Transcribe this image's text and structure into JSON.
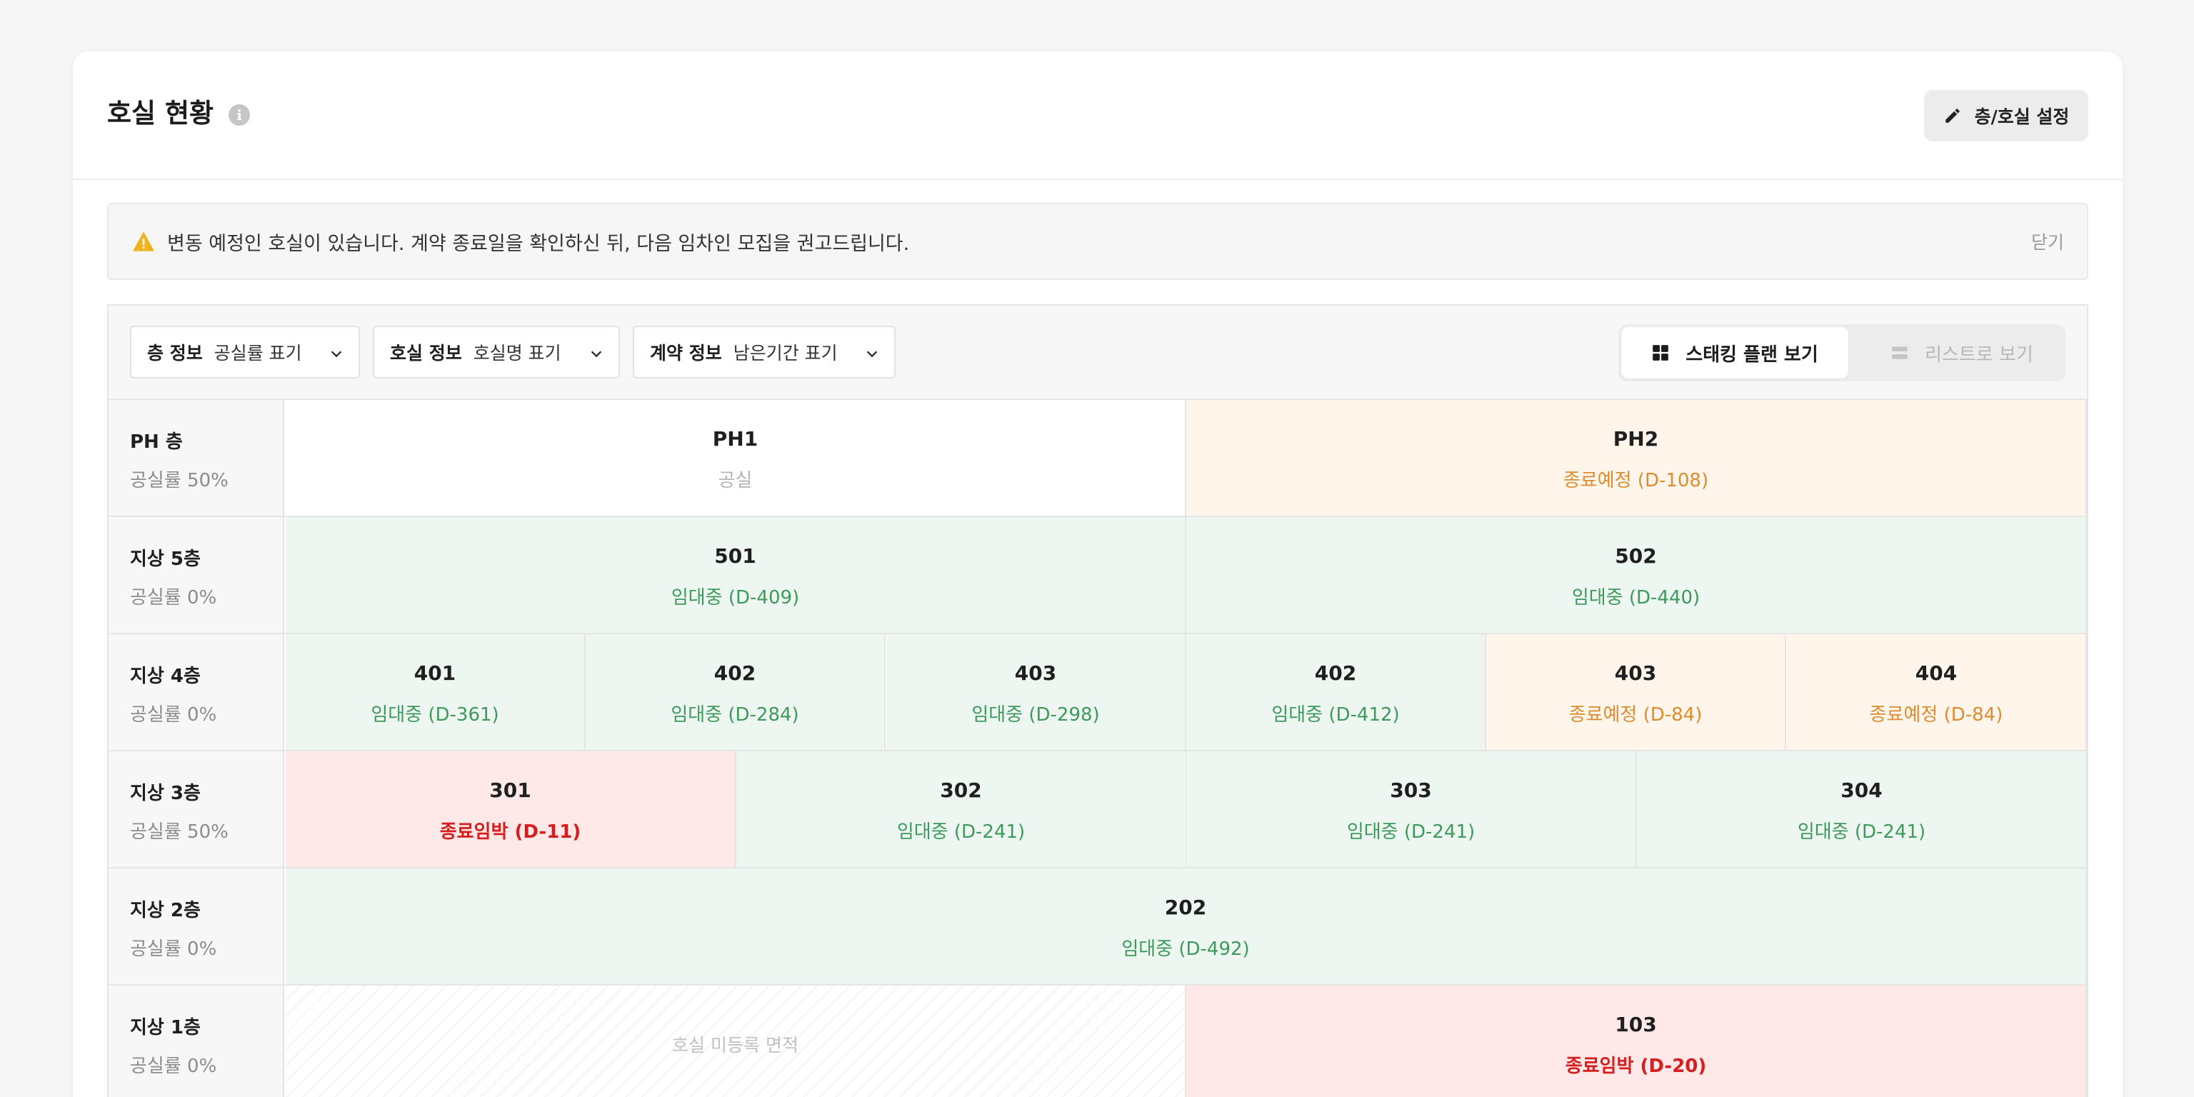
{
  "header": {
    "title": "호실 현황",
    "info_icon": "info-icon",
    "settings_button": "층/호실 설정",
    "settings_icon": "pencil-icon"
  },
  "alert": {
    "icon": "warning-icon",
    "message": "변동 예정인 호실이 있습니다. 계약 종료일을 확인하신 뒤, 다음 임차인 모집을 권고드립니다.",
    "close": "닫기"
  },
  "toolbar": {
    "filters": [
      {
        "label": "층 정보",
        "value": "공실률 표기"
      },
      {
        "label": "호실 정보",
        "value": "호실명 표기"
      },
      {
        "label": "계약 정보",
        "value": "남은기간 표기"
      }
    ],
    "views": [
      {
        "label": "스태킹 플랜 보기",
        "icon": "grid-icon",
        "active": true
      },
      {
        "label": "리스트로 보기",
        "icon": "list-icon",
        "active": false
      }
    ]
  },
  "colors": {
    "leased": "#3d9a5c",
    "ending": "#de8b2f",
    "urgent": "#d71e1e",
    "vacant": "#b5b5b5"
  },
  "floors": [
    {
      "name": "PH 층",
      "vacancy": "공실률 50%",
      "units": [
        {
          "name": "PH1",
          "status": "공실",
          "state": "vacant"
        },
        {
          "name": "PH2",
          "status": "종료예정 (D-108)",
          "state": "ending"
        }
      ]
    },
    {
      "name": "지상 5층",
      "vacancy": "공실률 0%",
      "units": [
        {
          "name": "501",
          "status": "임대중 (D-409)",
          "state": "leased"
        },
        {
          "name": "502",
          "status": "임대중 (D-440)",
          "state": "leased"
        }
      ]
    },
    {
      "name": "지상 4층",
      "vacancy": "공실률 0%",
      "units": [
        {
          "name": "401",
          "status": "임대중 (D-361)",
          "state": "leased"
        },
        {
          "name": "402",
          "status": "임대중 (D-284)",
          "state": "leased"
        },
        {
          "name": "403",
          "status": "임대중 (D-298)",
          "state": "leased"
        },
        {
          "name": "402",
          "status": "임대중 (D-412)",
          "state": "leased"
        },
        {
          "name": "403",
          "status": "종료예정 (D-84)",
          "state": "ending"
        },
        {
          "name": "404",
          "status": "종료예정 (D-84)",
          "state": "ending"
        }
      ]
    },
    {
      "name": "지상 3층",
      "vacancy": "공실률 50%",
      "units": [
        {
          "name": "301",
          "status": "종료임박 (D-11)",
          "state": "urgent"
        },
        {
          "name": "302",
          "status": "임대중 (D-241)",
          "state": "leased"
        },
        {
          "name": "303",
          "status": "임대중 (D-241)",
          "state": "leased"
        },
        {
          "name": "304",
          "status": "임대중 (D-241)",
          "state": "leased"
        }
      ]
    },
    {
      "name": "지상 2층",
      "vacancy": "공실률 0%",
      "units": [
        {
          "name": "202",
          "status": "임대중 (D-492)",
          "state": "leased"
        }
      ]
    },
    {
      "name": "지상 1층",
      "vacancy": "공실률 0%",
      "units": [
        {
          "name": "",
          "status": "",
          "note": "호실 미등록 면적",
          "state": "unreg"
        },
        {
          "name": "103",
          "status": "종료임박 (D-20)",
          "state": "urgent"
        }
      ]
    }
  ]
}
